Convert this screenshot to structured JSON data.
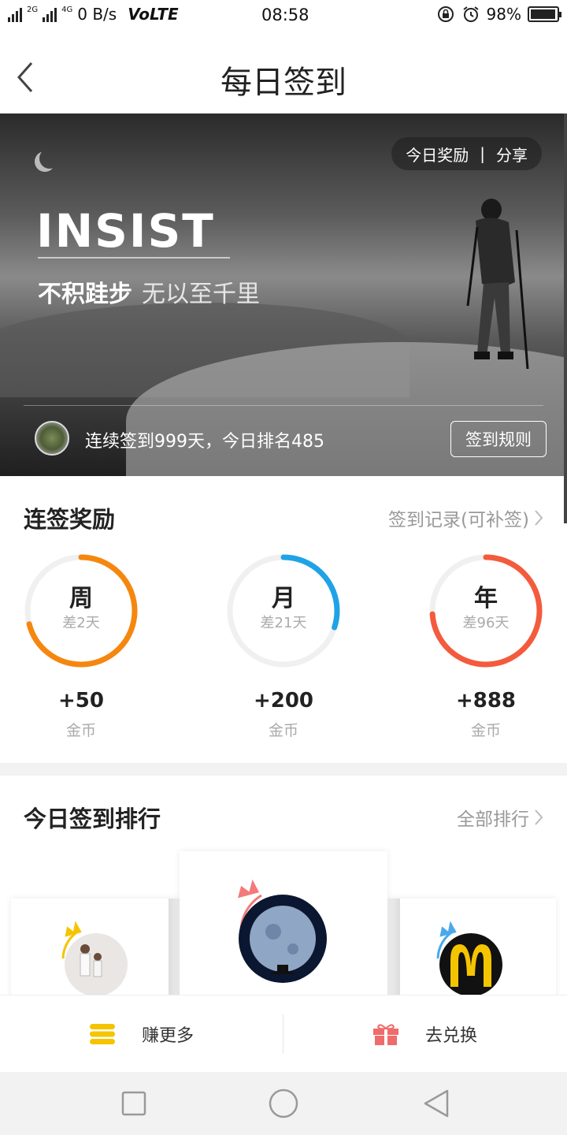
{
  "status_bar": {
    "network_1": "2G",
    "network_2": "4G",
    "speed": "0 B/s",
    "volte": "VoLTE",
    "time": "08:58",
    "battery": "98%",
    "battery_level": 0.98
  },
  "header": {
    "title": "每日签到"
  },
  "banner": {
    "pill_reward": "今日奖励",
    "pill_sep": "|",
    "pill_share": "分享",
    "headline": "INSIST",
    "motto_bold": "不积跬步",
    "motto_light": "无以至千里",
    "streak_text": "连续签到999天，今日排名485",
    "rules_button": "签到规则"
  },
  "rewards": {
    "title": "连签奖励",
    "link": "签到记录(可补签)",
    "items": [
      {
        "period": "周",
        "remaining": "差2天",
        "amount": "+50",
        "unit": "金币",
        "color": "#f5870f",
        "progress": 0.71
      },
      {
        "period": "月",
        "remaining": "差21天",
        "amount": "+200",
        "unit": "金币",
        "color": "#1fa3e6",
        "progress": 0.3
      },
      {
        "period": "年",
        "remaining": "差96天",
        "amount": "+888",
        "unit": "金币",
        "color": "#f45a3c",
        "progress": 0.74
      }
    ]
  },
  "ranking": {
    "title": "今日签到排行",
    "link": "全部排行"
  },
  "bottom_bar": {
    "earn_more": "赚更多",
    "redeem": "去兑换",
    "earn_color": "#f5c400",
    "redeem_color": "#f06b6b"
  }
}
